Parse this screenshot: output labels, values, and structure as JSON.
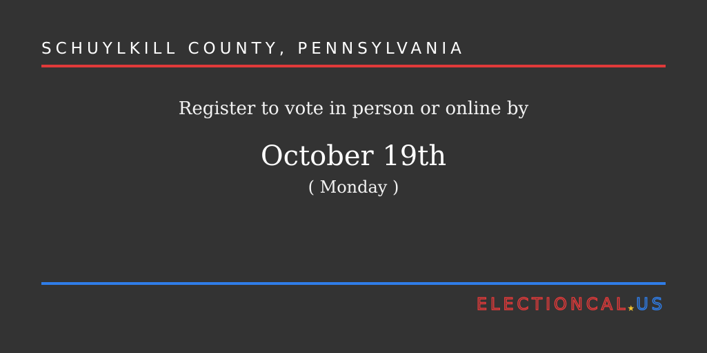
{
  "header": {
    "county": "SCHUYLKILL COUNTY, PENNSYLVANIA"
  },
  "main": {
    "intro": "Register to vote in person or online by",
    "date": "October 19th",
    "weekday": "( Monday )"
  },
  "footer": {
    "brand_name": "ELECTIONCAL",
    "brand_star": "★",
    "brand_tld": "US"
  },
  "colors": {
    "background": "#333333",
    "top_rule": "#e03a3a",
    "bottom_rule": "#2f7de8",
    "brand_red": "#e03a3a",
    "brand_blue": "#2f7de8",
    "star": "#f4c430"
  }
}
